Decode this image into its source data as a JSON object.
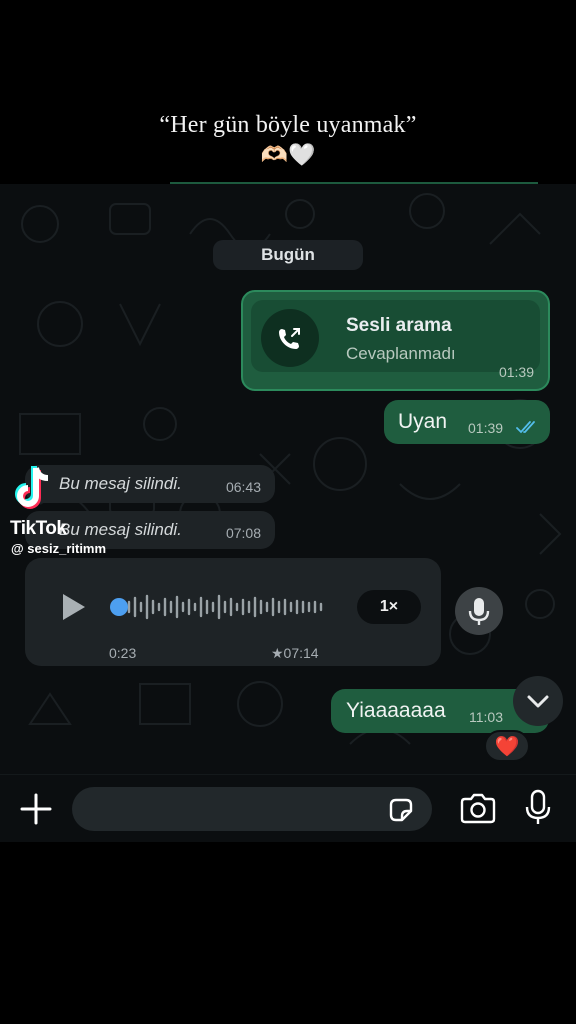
{
  "caption": {
    "text": "“Her gün böyle uyanmak”",
    "emoji": "🫶🏻🤍"
  },
  "chat": {
    "date_label": "Bugün",
    "call": {
      "title": "Sesli arama",
      "status": "Cevaplanmadı",
      "time": "01:39"
    },
    "messages": [
      {
        "text": "Uyan",
        "time": "01:39",
        "direction": "out",
        "read": true
      },
      {
        "text": "Bu mesaj silindi.",
        "time": "06:43",
        "direction": "in",
        "deleted": true
      },
      {
        "text": "Bu mesaj silindi.",
        "time": "07:08",
        "direction": "in",
        "deleted": true
      },
      {
        "text": "Yiaaaaaaa",
        "time": "11:03",
        "direction": "out",
        "reaction": "❤️"
      }
    ],
    "voice": {
      "duration": "0:23",
      "time": "★07:14",
      "speed": "1×",
      "progress": 0.0
    }
  },
  "watermark": {
    "brand": "TikTok",
    "user": "@ sesiz_ritimm"
  },
  "input": {
    "placeholder": ""
  },
  "colors": {
    "outgoing_bubble": "#1f5d3f",
    "incoming_bubble": "#1e2326",
    "read_ticks": "#53bdeb",
    "chat_bg": "#0b0e10"
  }
}
